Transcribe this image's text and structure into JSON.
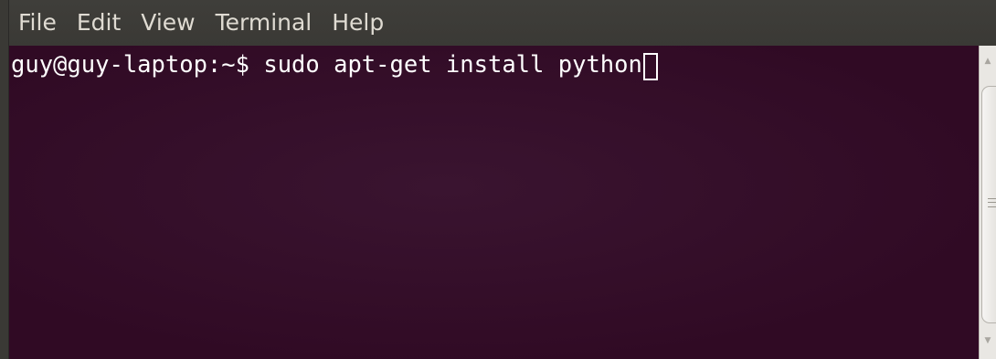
{
  "menubar": {
    "items": [
      {
        "label": "File"
      },
      {
        "label": "Edit"
      },
      {
        "label": "View"
      },
      {
        "label": "Terminal"
      },
      {
        "label": "Help"
      }
    ]
  },
  "terminal": {
    "prompt": "guy@guy-laptop:~$ ",
    "command": "sudo apt-get install python"
  },
  "colors": {
    "menubar_bg": "#3c3b37",
    "menubar_text": "#dfdbd2",
    "terminal_bg": "#300a24",
    "terminal_text": "#ffffff",
    "scrollbar_bg": "#e9e7e3"
  },
  "icons": {
    "scroll_up": "scroll-up-arrow-icon",
    "scroll_down": "scroll-down-arrow-icon"
  }
}
